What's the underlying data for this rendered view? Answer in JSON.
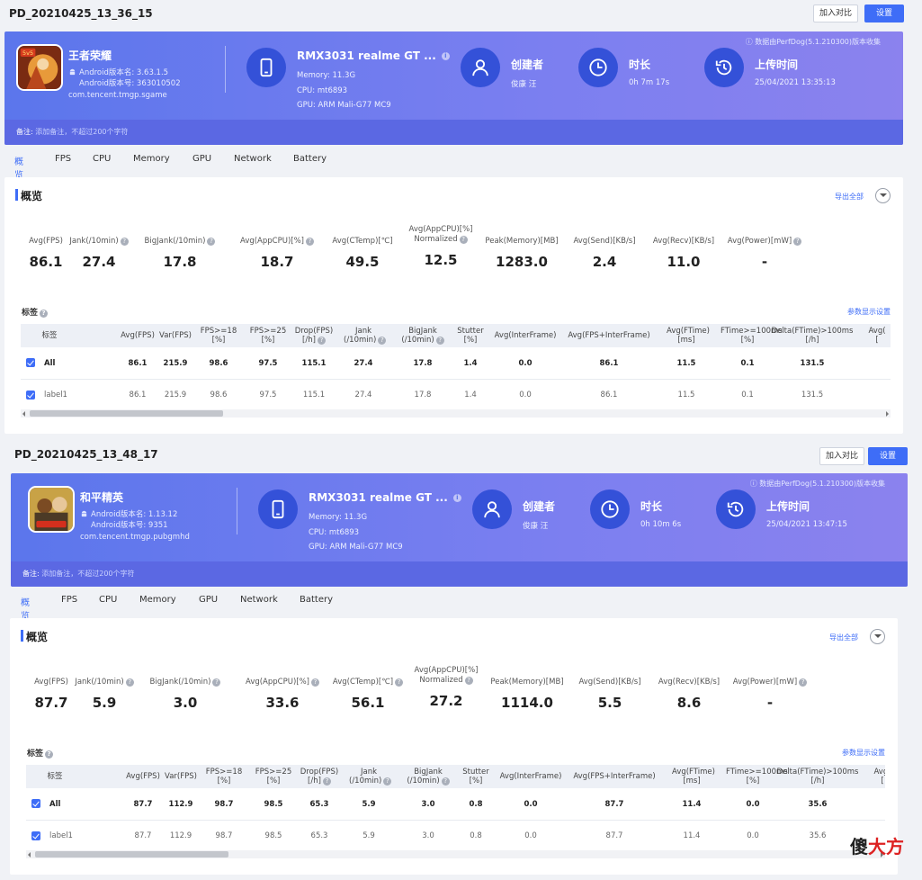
{
  "reports": [
    {
      "title": "PD_20210425_13_36_15",
      "compare_label": "加入对比",
      "settings_label": "设置",
      "app": {
        "name": "王者荣耀",
        "android_version": "Android版本名: 3.63.1.5",
        "android_code": "Android版本号: 363010502",
        "package": "com.tencent.tmgp.sgame"
      },
      "device": {
        "name": "RMX3031 realme GT ...",
        "memory": "Memory: 11.3G",
        "cpu": "CPU: mt6893",
        "gpu": "GPU: ARM Mali-G77 MC9"
      },
      "creator": {
        "title": "创建者",
        "value": "俊康 汪"
      },
      "duration": {
        "title": "时长",
        "value": "0h 7m 17s"
      },
      "upload": {
        "title": "上传时间",
        "value": "25/04/2021 13:35:13"
      },
      "source_note": "ⓘ 数据由PerfDog(5.1.210300)版本收集",
      "note_label": "备注:",
      "note_placeholder": "添加备注，不超过200个字符",
      "tabs": [
        "概览",
        "FPS",
        "CPU",
        "Memory",
        "GPU",
        "Network",
        "Battery"
      ],
      "overview_title": "概览",
      "export_label": "导出全部",
      "metrics": [
        {
          "label": "Avg(FPS)",
          "value": "86.1"
        },
        {
          "label": "Jank(/10min)",
          "value": "27.4",
          "help": true
        },
        {
          "label": "BigJank(/10min)",
          "value": "17.8",
          "help": true
        },
        {
          "label": "Avg(AppCPU)[%]",
          "value": "18.7",
          "help": true
        },
        {
          "label": "Avg(CTemp)[℃]",
          "value": "49.5"
        },
        {
          "label": "Avg(AppCPU)[%]",
          "label2": "Normalized",
          "value": "12.5",
          "help": true
        },
        {
          "label": "Peak(Memory)[MB]",
          "value": "1283.0"
        },
        {
          "label": "Avg(Send)[KB/s]",
          "value": "2.4"
        },
        {
          "label": "Avg(Recv)[KB/s]",
          "value": "11.0"
        },
        {
          "label": "Avg(Power)[mW]",
          "value": "-",
          "help": true
        }
      ],
      "tags_title": "标签",
      "param_link": "参数显示设置",
      "columns": [
        "标签",
        "Avg(FPS)",
        "Var(FPS)",
        "FPS>=18|[%]",
        "FPS>=25|[%]",
        "Drop(FPS)|[/h]",
        "Jank|(/10min)",
        "BigJank|(/10min)",
        "Stutter|[%]",
        "Avg(InterFrame)",
        "Avg(FPS+InterFrame)",
        "Avg(FTime)|[ms]",
        "FTime>=100ms|[%]",
        "Delta(FTime)>100ms|[/h]",
        "Avg(|["
      ],
      "rows": [
        {
          "label": "All",
          "values": [
            "86.1",
            "215.9",
            "98.6",
            "97.5",
            "115.1",
            "27.4",
            "17.8",
            "1.4",
            "0.0",
            "86.1",
            "11.5",
            "0.1",
            "131.5"
          ]
        },
        {
          "label": "label1",
          "values": [
            "86.1",
            "215.9",
            "98.6",
            "97.5",
            "115.1",
            "27.4",
            "17.8",
            "1.4",
            "0.0",
            "86.1",
            "11.5",
            "0.1",
            "131.5"
          ]
        }
      ]
    },
    {
      "title": "PD_20210425_13_48_17",
      "compare_label": "加入对比",
      "settings_label": "设置",
      "app": {
        "name": "和平精英",
        "android_version": "Android版本名: 1.13.12",
        "android_code": "Android版本号: 9351",
        "package": "com.tencent.tmgp.pubgmhd"
      },
      "device": {
        "name": "RMX3031 realme GT ...",
        "memory": "Memory: 11.3G",
        "cpu": "CPU: mt6893",
        "gpu": "GPU: ARM Mali-G77 MC9"
      },
      "creator": {
        "title": "创建者",
        "value": "俊康 汪"
      },
      "duration": {
        "title": "时长",
        "value": "0h 10m 6s"
      },
      "upload": {
        "title": "上传时间",
        "value": "25/04/2021 13:47:15"
      },
      "source_note": "ⓘ 数据由PerfDog(5.1.210300)版本收集",
      "note_label": "备注:",
      "note_placeholder": "添加备注，不超过200个字符",
      "tabs": [
        "概览",
        "FPS",
        "CPU",
        "Memory",
        "GPU",
        "Network",
        "Battery"
      ],
      "overview_title": "概览",
      "export_label": "导出全部",
      "metrics": [
        {
          "label": "Avg(FPS)",
          "value": "87.7"
        },
        {
          "label": "Jank(/10min)",
          "value": "5.9",
          "help": true
        },
        {
          "label": "BigJank(/10min)",
          "value": "3.0",
          "help": true
        },
        {
          "label": "Avg(AppCPU)[%]",
          "value": "33.6",
          "help": true
        },
        {
          "label": "Avg(CTemp)[℃]",
          "value": "56.1",
          "help": true
        },
        {
          "label": "Avg(AppCPU)[%]",
          "label2": "Normalized",
          "value": "27.2",
          "help": true
        },
        {
          "label": "Peak(Memory)[MB]",
          "value": "1114.0"
        },
        {
          "label": "Avg(Send)[KB/s]",
          "value": "5.5"
        },
        {
          "label": "Avg(Recv)[KB/s]",
          "value": "8.6"
        },
        {
          "label": "Avg(Power)[mW]",
          "value": "-",
          "help": true
        }
      ],
      "tags_title": "标签",
      "param_link": "参数显示设置",
      "columns": [
        "标签",
        "Avg(FPS)",
        "Var(FPS)",
        "FPS>=18|[%]",
        "FPS>=25|[%]",
        "Drop(FPS)|[/h]",
        "Jank|(/10min)",
        "BigJank|(/10min)",
        "Stutter|[%]",
        "Avg(InterFrame)",
        "Avg(FPS+InterFrame)",
        "Avg(FTime)|[ms]",
        "FTime>=100ms|[%]",
        "Delta(FTime)>100ms|[/h]",
        "Avg(|["
      ],
      "rows": [
        {
          "label": "All",
          "values": [
            "87.7",
            "112.9",
            "98.7",
            "98.5",
            "65.3",
            "5.9",
            "3.0",
            "0.8",
            "0.0",
            "87.7",
            "11.4",
            "0.0",
            "35.6"
          ]
        },
        {
          "label": "label1",
          "values": [
            "87.7",
            "112.9",
            "98.7",
            "98.5",
            "65.3",
            "5.9",
            "3.0",
            "0.8",
            "0.0",
            "87.7",
            "11.4",
            "0.0",
            "35.6"
          ]
        }
      ]
    }
  ],
  "watermark": {
    "part1": "傻",
    "part2": "大方"
  },
  "colors": {
    "accent": "#3e6df7",
    "banner": "#6a7aee",
    "circle": "#3451d8"
  },
  "icons": [
    "android-icon",
    "phone-icon",
    "user-icon",
    "clock-icon",
    "history-icon",
    "help-icon",
    "info-icon",
    "chevron-down-icon",
    "checkbox-icon"
  ]
}
